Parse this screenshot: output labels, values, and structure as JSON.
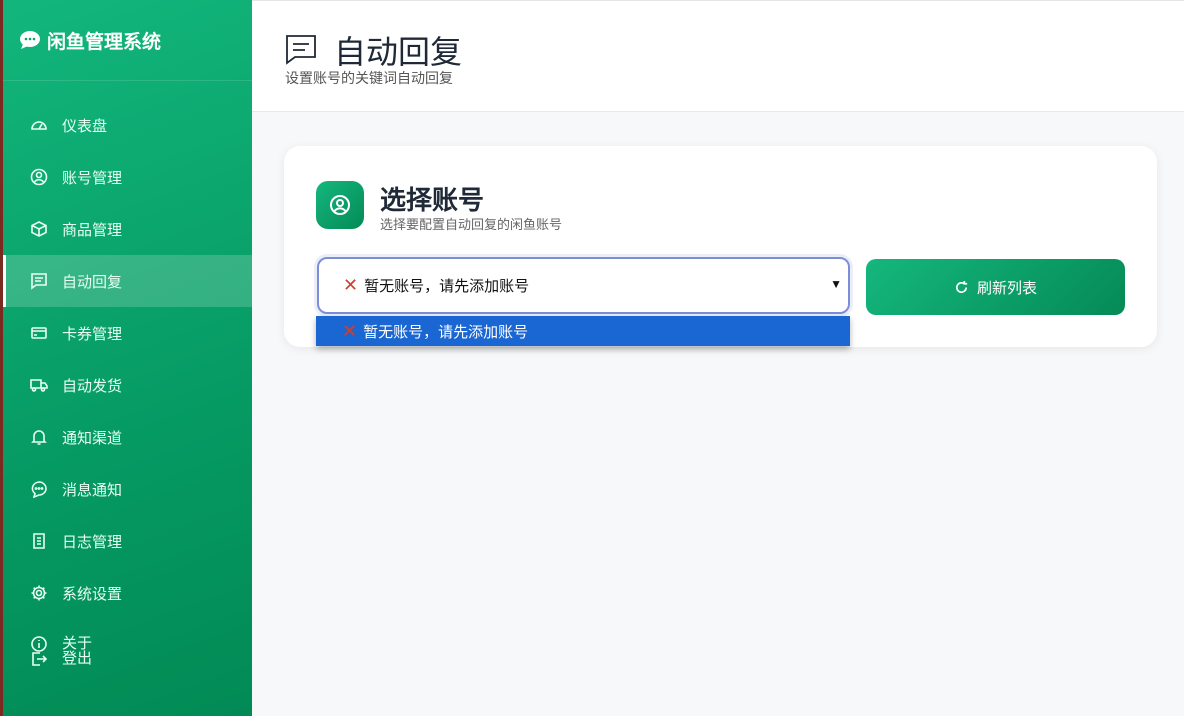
{
  "sidebar": {
    "brand": "闲鱼管理系统",
    "items": [
      {
        "label": "仪表盘",
        "icon": "dashboard-icon"
      },
      {
        "label": "账号管理",
        "icon": "user-circle-icon"
      },
      {
        "label": "商品管理",
        "icon": "box-icon"
      },
      {
        "label": "自动回复",
        "icon": "chat-icon"
      },
      {
        "label": "卡券管理",
        "icon": "card-icon"
      },
      {
        "label": "自动发货",
        "icon": "truck-icon"
      },
      {
        "label": "通知渠道",
        "icon": "bell-icon"
      },
      {
        "label": "消息通知",
        "icon": "message-icon"
      },
      {
        "label": "日志管理",
        "icon": "log-icon"
      },
      {
        "label": "系统设置",
        "icon": "gear-icon"
      }
    ],
    "about": "关于",
    "logout": "登出"
  },
  "header": {
    "title": "自动回复",
    "subtitle": "设置账号的关键词自动回复"
  },
  "card": {
    "title": "选择账号",
    "subtitle": "选择要配置自动回复的闲鱼账号",
    "select_value": "暂无账号，请先添加账号",
    "option": "暂无账号，请先添加账号",
    "refresh": "刷新列表"
  }
}
